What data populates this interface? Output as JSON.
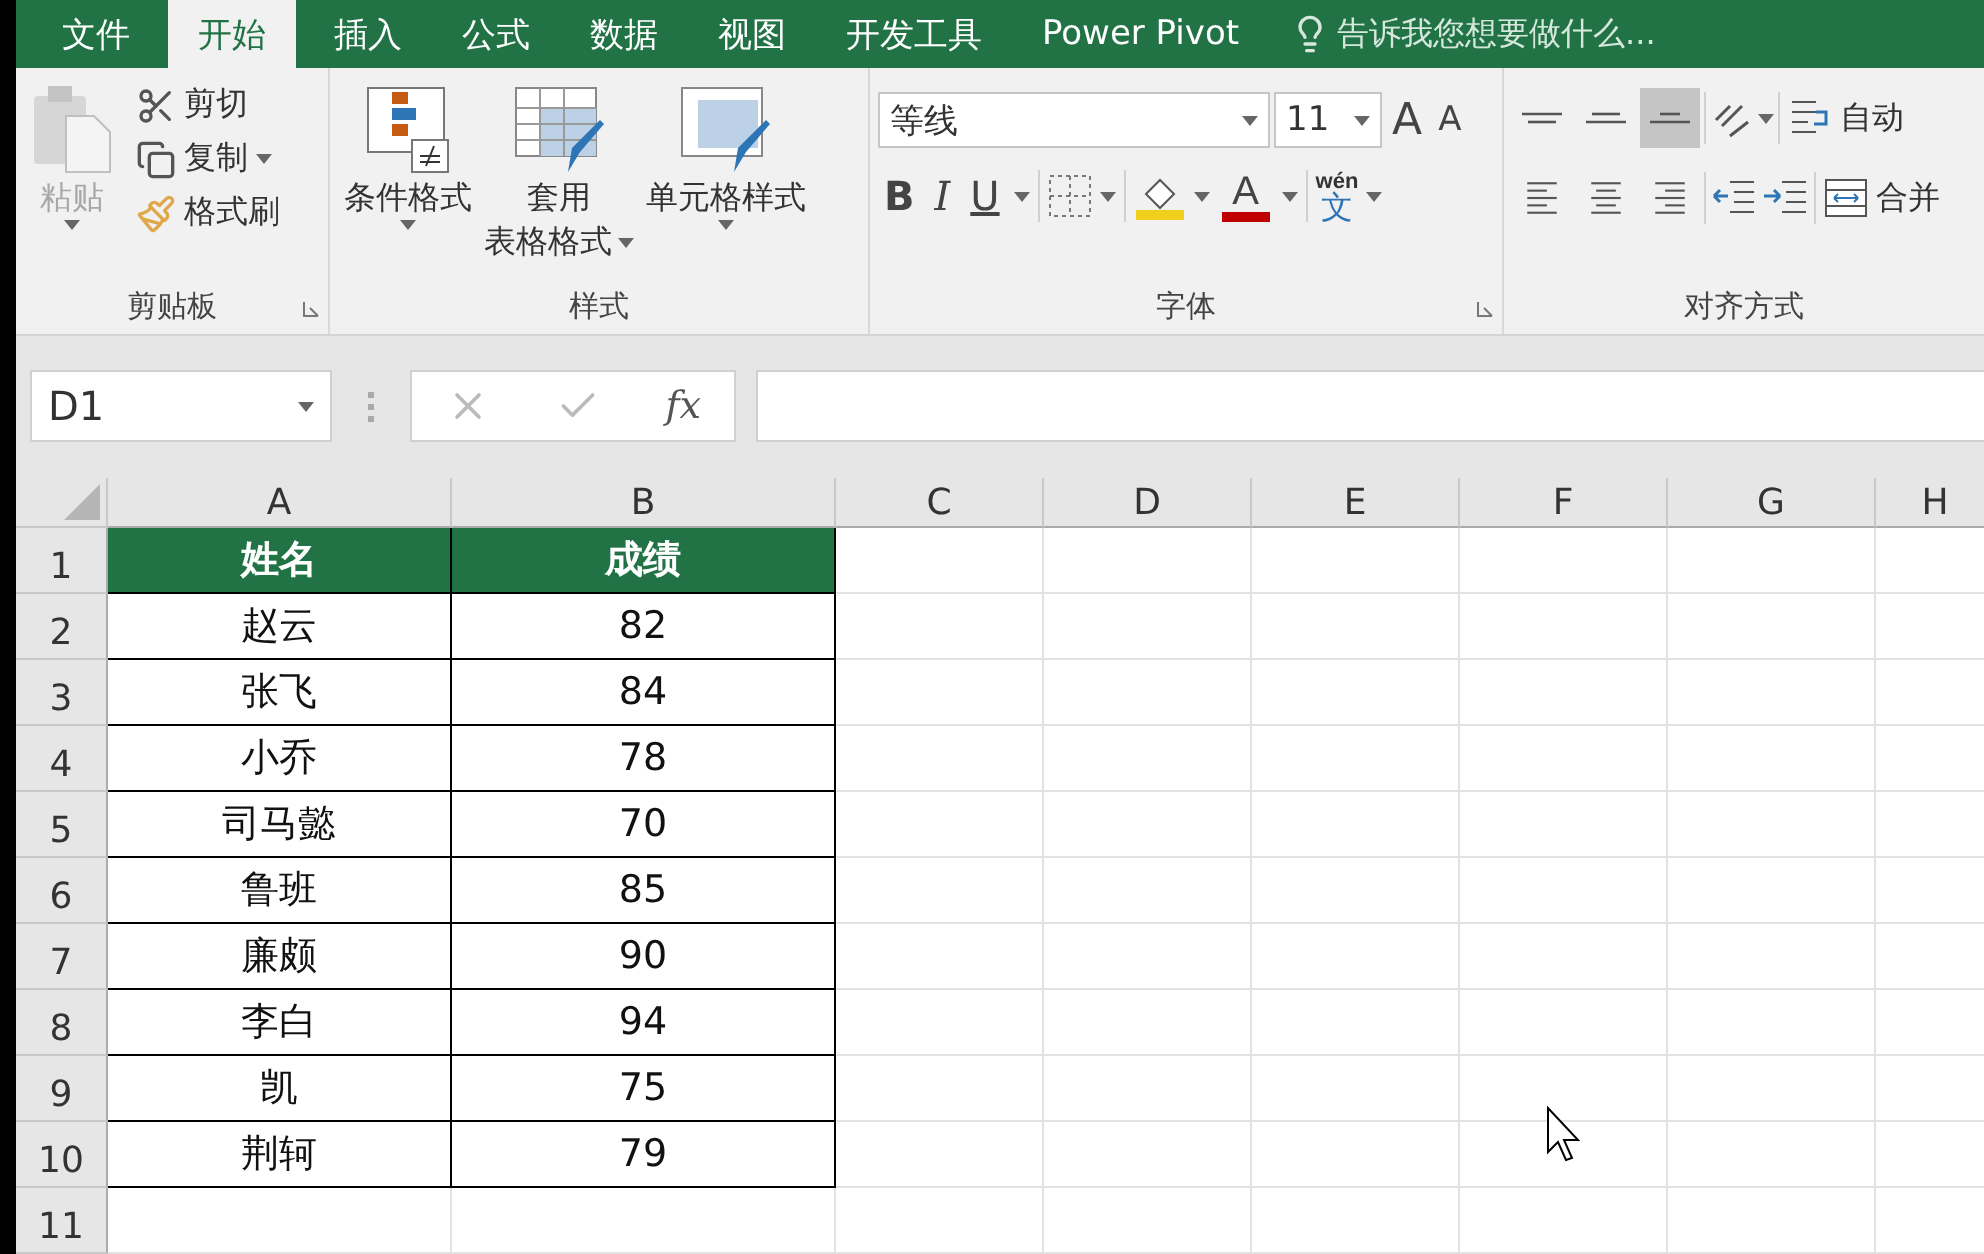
{
  "tabs": [
    {
      "label": "文件",
      "selected": false
    },
    {
      "label": "开始",
      "selected": true
    },
    {
      "label": "插入",
      "selected": false
    },
    {
      "label": "公式",
      "selected": false
    },
    {
      "label": "数据",
      "selected": false
    },
    {
      "label": "视图",
      "selected": false
    },
    {
      "label": "开发工具",
      "selected": false
    },
    {
      "label": "Power Pivot",
      "selected": false
    }
  ],
  "tell_me": "告诉我您想要做什么...",
  "clipboard": {
    "title": "剪贴板",
    "paste": {
      "label": "粘贴",
      "disabled": true
    },
    "cut": "剪切",
    "copy": "复制",
    "format_painter": "格式刷"
  },
  "styles": {
    "title": "样式",
    "conditional_format": "条件格式",
    "table_format": [
      "套用",
      "表格格式"
    ],
    "cell_styles": "单元格样式"
  },
  "font": {
    "title": "字体",
    "name": "等线",
    "size": "11",
    "grow": "A",
    "shrink": "A",
    "bold": "B",
    "italic": "I",
    "underline": "U",
    "font_color": "A",
    "phonetic_top": "wén",
    "phonetic_bottom": "文"
  },
  "alignment": {
    "title": "对齐方式",
    "vertical": [
      {
        "kind": "top",
        "selected": false
      },
      {
        "kind": "middle",
        "selected": false
      },
      {
        "kind": "bottom",
        "selected": true
      }
    ],
    "wrap_text": "自动",
    "merge": "合并"
  },
  "name_box": "D1",
  "formula_label": "fx",
  "columns": [
    "A",
    "B",
    "C",
    "D",
    "E",
    "F",
    "G",
    "H"
  ],
  "rows": [
    {
      "number": "1",
      "kind": "header",
      "cells": [
        "姓名",
        "成绩"
      ]
    },
    {
      "number": "2",
      "kind": "data",
      "cells": [
        "赵云",
        "82"
      ]
    },
    {
      "number": "3",
      "kind": "data",
      "cells": [
        "张飞",
        "84"
      ]
    },
    {
      "number": "4",
      "kind": "data",
      "cells": [
        "小乔",
        "78"
      ]
    },
    {
      "number": "5",
      "kind": "data",
      "cells": [
        "司马懿",
        "70"
      ]
    },
    {
      "number": "6",
      "kind": "data",
      "cells": [
        "鲁班",
        "85"
      ]
    },
    {
      "number": "7",
      "kind": "data",
      "cells": [
        "廉颇",
        "90"
      ]
    },
    {
      "number": "8",
      "kind": "data",
      "cells": [
        "李白",
        "94"
      ]
    },
    {
      "number": "9",
      "kind": "data",
      "cells": [
        "凯",
        "75"
      ]
    },
    {
      "number": "10",
      "kind": "data",
      "cells": [
        "荆轲",
        "79"
      ]
    },
    {
      "number": "11",
      "kind": "empty",
      "cells": []
    }
  ]
}
